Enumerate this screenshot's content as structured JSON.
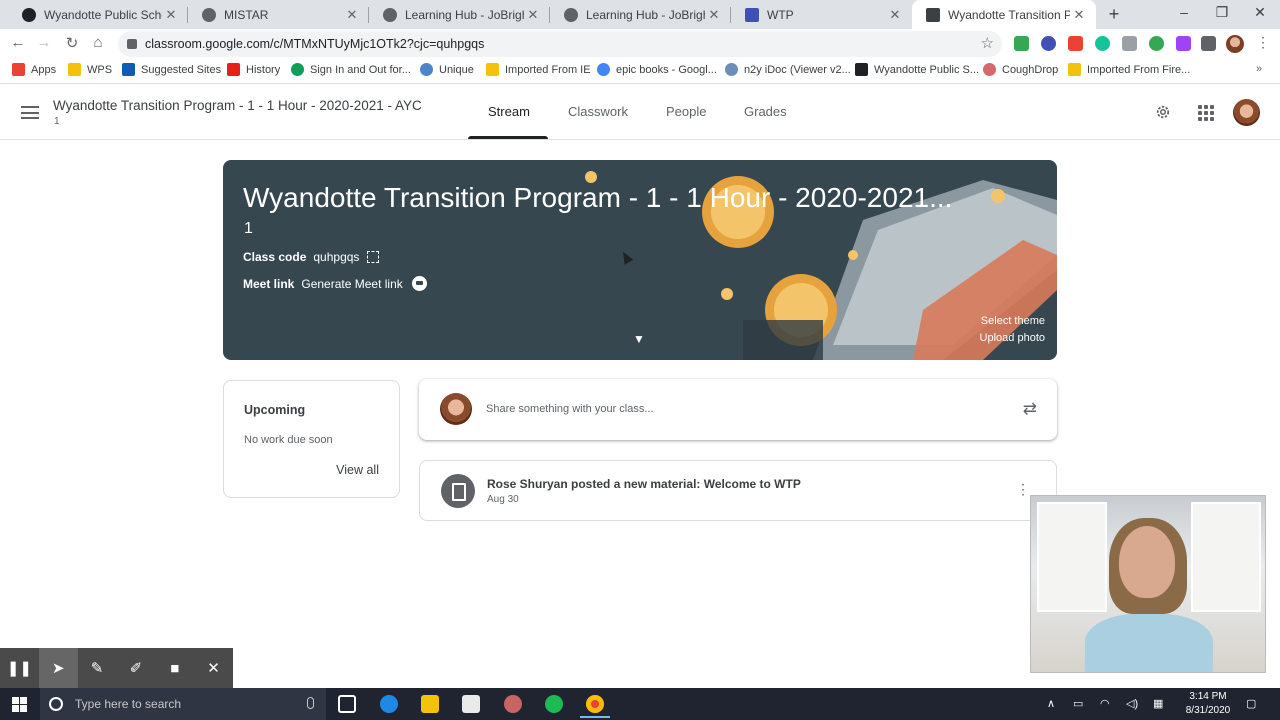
{
  "browser": {
    "tabs": [
      {
        "title": "Wyandotte Public Schools - /",
        "icon": "wyandotte-logo-icon"
      },
      {
        "title": "MISTAR",
        "icon": "globe-icon"
      },
      {
        "title": "Learning Hub - JoBrighton C",
        "icon": "globe-icon"
      },
      {
        "title": "Learning Hub - JoBrighton C",
        "icon": "globe-icon"
      },
      {
        "title": "WTP",
        "icon": "docs-icon"
      },
      {
        "title": "Wyandotte Transition Progra",
        "icon": "classroom-icon",
        "active": true
      }
    ],
    "url": "classroom.google.com/c/MTMxNTUyMjc1OTk2?cjc=quhpgqs",
    "bookmarks": [
      {
        "label": "Apps",
        "color": "#ea4335"
      },
      {
        "label": "WPS",
        "color": "#f4c20d"
      },
      {
        "label": "Suggested Sites",
        "color": "#0f5cb8"
      },
      {
        "label": "History",
        "color": "#e62117"
      },
      {
        "label": "Sign In and Out for...",
        "color": "#0f9d58"
      },
      {
        "label": "Unique",
        "color": "#4a86c8"
      },
      {
        "label": "Imported From IE",
        "color": "#f4c20d"
      },
      {
        "label": "epic books - Googl...",
        "color": "#4285f4"
      },
      {
        "label": "n2y iDoc (Viewer v2...",
        "color": "#6d8fb7"
      },
      {
        "label": "Wyandotte Public S...",
        "color": "#202124"
      },
      {
        "label": "CoughDrop",
        "color": "#d46a6a"
      },
      {
        "label": "Imported From Fire...",
        "color": "#f4c20d"
      }
    ]
  },
  "classroom": {
    "title": "Wyandotte Transition Program - 1 - 1 Hour - 2020-2021 - AYC",
    "subtitle": "1",
    "nav": [
      "Stream",
      "Classwork",
      "People",
      "Grades"
    ],
    "banner": {
      "title": "Wyandotte Transition Program - 1 - 1 Hour - 2020-2021...",
      "section": "1",
      "class_code_label": "Class code",
      "class_code": "quhpgqs",
      "meet_label": "Meet link",
      "meet_action": "Generate Meet link",
      "select_theme": "Select theme",
      "upload_photo": "Upload photo"
    },
    "upcoming": {
      "heading": "Upcoming",
      "text": "No work due soon",
      "link": "View all"
    },
    "share_placeholder": "Share something with your class...",
    "post": {
      "text": "Rose Shuryan posted a new material: Welcome to WTP",
      "date": "Aug 30"
    }
  },
  "taskbar": {
    "search_placeholder": "Type here to search",
    "time": "3:14 PM",
    "date": "8/31/2020"
  }
}
